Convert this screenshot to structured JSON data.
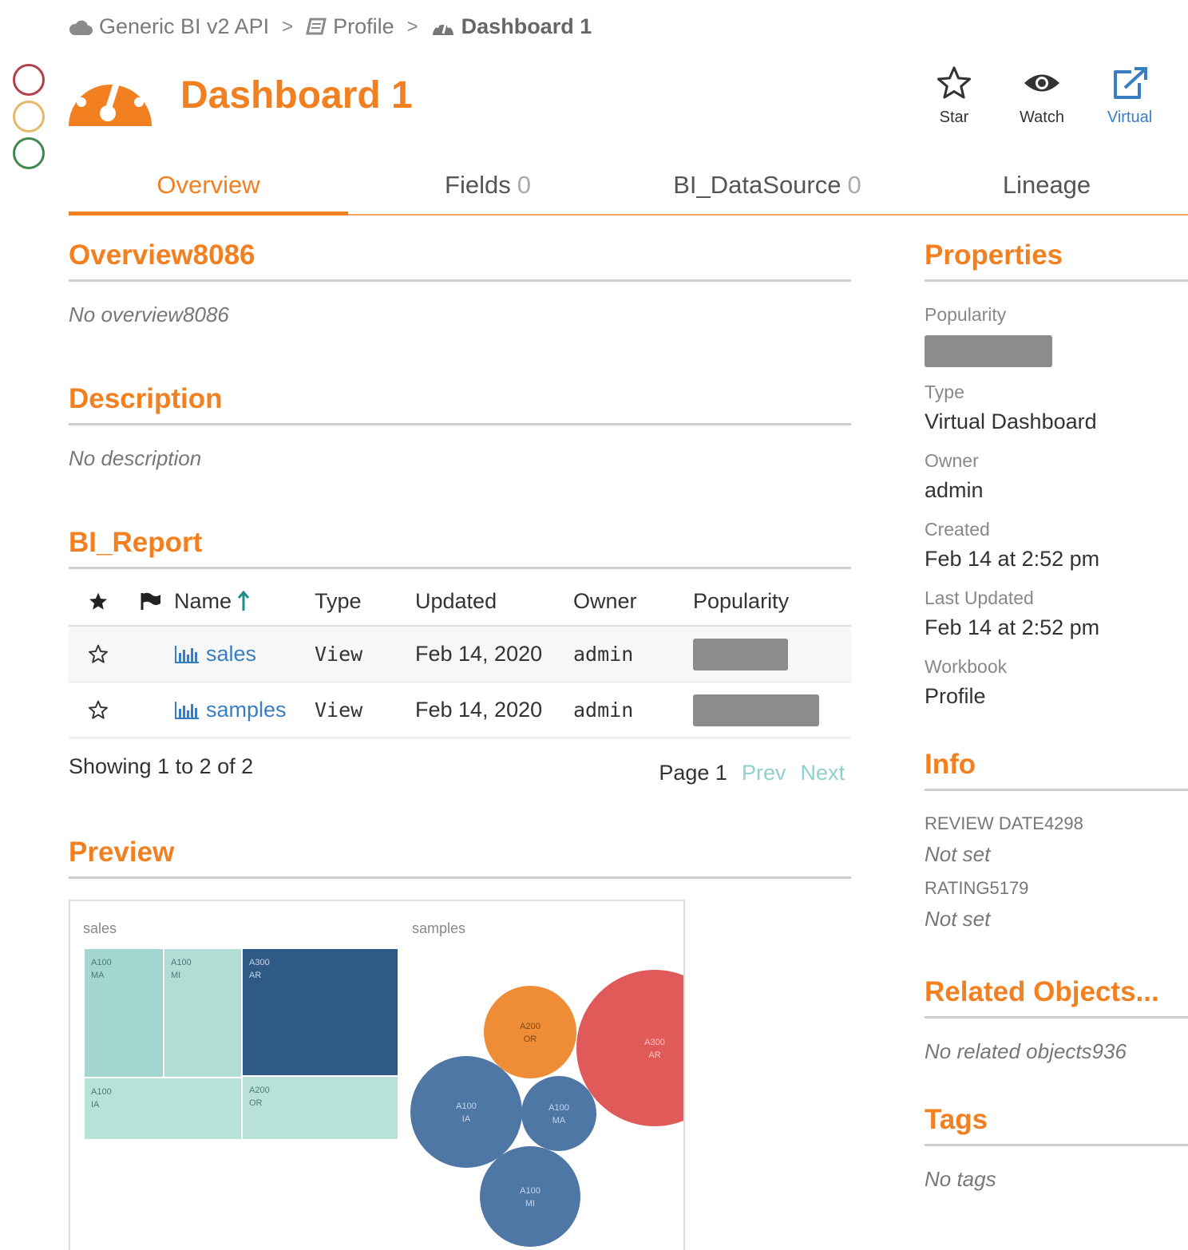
{
  "breadcrumb": [
    {
      "label": "Generic BI v2 API",
      "icon": "cloud-icon"
    },
    {
      "label": "Profile",
      "icon": "book-icon"
    },
    {
      "label": "Dashboard 1",
      "icon": "dashboard-icon"
    }
  ],
  "header": {
    "title": "Dashboard 1"
  },
  "actions": {
    "star": "Star",
    "watch": "Watch",
    "virtual": "Virtual"
  },
  "tabs": [
    {
      "label": "Overview",
      "count": ""
    },
    {
      "label": "Fields",
      "count": "0"
    },
    {
      "label": "BI_DataSource",
      "count": "0"
    },
    {
      "label": "Lineage",
      "count": ""
    }
  ],
  "overview": {
    "title": "Overview8086",
    "empty": "No overview8086"
  },
  "description": {
    "title": "Description",
    "empty": "No description"
  },
  "report": {
    "title": "BI_Report",
    "columns": {
      "name": "Name",
      "type": "Type",
      "updated": "Updated",
      "owner": "Owner",
      "popularity": "Popularity"
    },
    "rows": [
      {
        "name": "sales",
        "type": "View",
        "updated": "Feb 14, 2020",
        "owner": "admin",
        "popularity": 0.6
      },
      {
        "name": "samples",
        "type": "View",
        "updated": "Feb 14, 2020",
        "owner": "admin",
        "popularity": 0.8
      }
    ],
    "showing": "Showing 1 to 2 of 2",
    "page": "Page 1",
    "prev": "Prev",
    "next": "Next"
  },
  "preview": {
    "title": "Preview",
    "treemap_title": "sales",
    "bubble_title": "samples",
    "treemap_cells": [
      {
        "label1": "A100",
        "label2": "MA",
        "color": "#a3d6d1"
      },
      {
        "label1": "A100",
        "label2": "MI",
        "color": "#b2ddd5"
      },
      {
        "label1": "A300",
        "label2": "AR",
        "color": "#2f5a88"
      },
      {
        "label1": "A100",
        "label2": "IA",
        "color": "#b8e1d8"
      },
      {
        "label1": "A200",
        "label2": "OR",
        "color": "#b8e1d8"
      }
    ],
    "bubbles": [
      {
        "label1": "A200",
        "label2": "OR",
        "color": "#ef8c36"
      },
      {
        "label1": "A300",
        "label2": "AR",
        "color": "#e05a5a"
      },
      {
        "label1": "A100",
        "label2": "IA",
        "color": "#4f77a6"
      },
      {
        "label1": "A100",
        "label2": "MA",
        "color": "#4f77a6"
      },
      {
        "label1": "A100",
        "label2": "MI",
        "color": "#4f77a6"
      }
    ]
  },
  "properties": {
    "title": "Properties",
    "popularity_label": "Popularity",
    "popularity": 0.5,
    "type_label": "Type",
    "type": "Virtual Dashboard",
    "owner_label": "Owner",
    "owner": "admin",
    "created_label": "Created",
    "created": "Feb 14 at 2:52 pm",
    "updated_label": "Last Updated",
    "updated": "Feb 14 at 2:52 pm",
    "workbook_label": "Workbook",
    "workbook": "Profile"
  },
  "info": {
    "title": "Info",
    "items": [
      {
        "label": "REVIEW DATE4298",
        "value": "Not set"
      },
      {
        "label": "RATING5179",
        "value": "Not set"
      }
    ]
  },
  "related": {
    "title": "Related Objects...",
    "empty": "No related objects936"
  },
  "tags": {
    "title": "Tags",
    "empty": "No tags"
  },
  "colors": {
    "accent": "#f28020",
    "link": "#3a7ec2",
    "status_red": "#b5404a",
    "status_yellow": "#e8b86a",
    "status_green": "#3f8a4a"
  }
}
